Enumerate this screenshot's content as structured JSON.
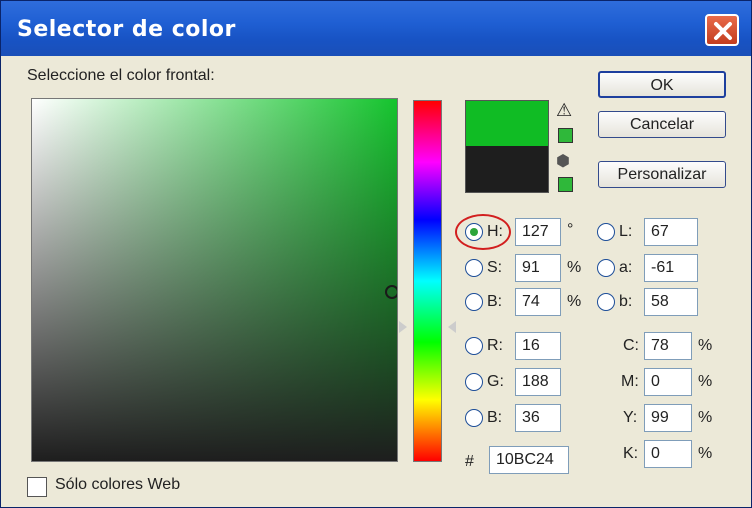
{
  "window": {
    "title": "Selector de color"
  },
  "prompt": "Seleccione el color frontal:",
  "colors": {
    "new": "#10BC24",
    "old": "#1e1e1e",
    "gamut": "#2fb83a"
  },
  "icons": {
    "warning": "⚠",
    "cube": "⬢"
  },
  "buttons": {
    "ok": "OK",
    "cancel": "Cancelar",
    "custom": "Personalizar"
  },
  "hsb": [
    {
      "label": "H:",
      "value": "127",
      "unit": "°",
      "selected": true
    },
    {
      "label": "S:",
      "value": "91",
      "unit": "%"
    },
    {
      "label": "B:",
      "value": "74",
      "unit": "%"
    }
  ],
  "lab": [
    {
      "label": "L:",
      "value": "67"
    },
    {
      "label": "a:",
      "value": "-61"
    },
    {
      "label": "b:",
      "value": "58"
    }
  ],
  "rgb": [
    {
      "label": "R:",
      "value": "16"
    },
    {
      "label": "G:",
      "value": "188"
    },
    {
      "label": "B:",
      "value": "36"
    }
  ],
  "cmyk": [
    {
      "label": "C:",
      "value": "78",
      "unit": "%"
    },
    {
      "label": "M:",
      "value": "0",
      "unit": "%"
    },
    {
      "label": "Y:",
      "value": "99",
      "unit": "%"
    },
    {
      "label": "K:",
      "value": "0",
      "unit": "%"
    }
  ],
  "hex": {
    "label": "#",
    "value": "10BC24"
  },
  "web_only": {
    "label": "Sólo colores Web",
    "checked": false
  }
}
